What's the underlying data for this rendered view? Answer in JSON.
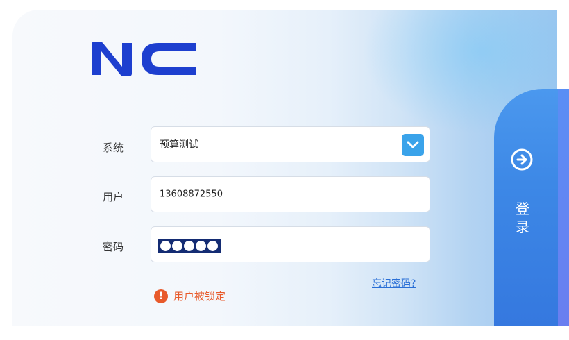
{
  "logo": {
    "text": "NC",
    "color": "#1d3fcf"
  },
  "form": {
    "system": {
      "label": "系统",
      "value": "预算测试",
      "dropdown_icon": "chevron-down-icon"
    },
    "user": {
      "label": "用户",
      "value": "13608872550"
    },
    "password": {
      "label": "密码",
      "masked_length": 5
    }
  },
  "forgot_password": "忘记密码?",
  "error": {
    "icon": "exclamation-icon",
    "text": "用户被锁定",
    "color": "#e85a2b"
  },
  "login_button": {
    "label": "登录",
    "icon": "arrow-right-circle-icon"
  },
  "colors": {
    "accent": "#3aa3ea",
    "login": "#3d88e6",
    "mask": "#142c73"
  }
}
